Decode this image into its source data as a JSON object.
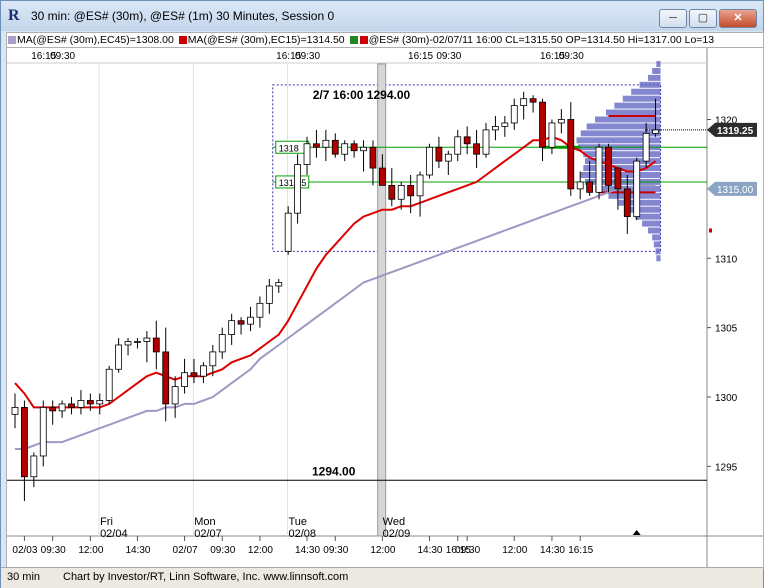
{
  "window": {
    "title": "30 min: @ES# (30m), @ES# (1m) 30 Minutes, Session 0",
    "minimize_label": "─",
    "maximize_label": "▢",
    "close_label": "✕"
  },
  "legend": [
    {
      "text": "MA(@ES# (30m),EC45)=1308.00",
      "color": "#a8a0cc"
    },
    {
      "text": "MA(@ES# (30m),EC15)=1314.50",
      "color": "#cc0000"
    },
    {
      "text": "@ES# (30m)-02/07/11 16:00 CL=1315.50 OP=1314.50 Hi=1317.00 Lo=13",
      "color": "#228822",
      "color2": "#cc0000"
    }
  ],
  "colors": {
    "ema15": "#dd0000",
    "ema45": "#9d98c4",
    "up_candle": "#ffffff",
    "down_candle": "#b00000",
    "profile_fill": "#5a5fc0",
    "range_box": "#3333aa",
    "hline": "#00a000",
    "last_price": "#2c2c2c",
    "price_tag_gray": "#8ca4c4"
  },
  "chart_data": {
    "type": "candlestick",
    "ylim": [
      1292,
      1324
    ],
    "y_ticks": [
      "1320",
      "1315",
      "1310",
      "1305",
      "1300",
      "1295"
    ],
    "top_time_labels": [
      {
        "text": "16:15",
        "bar": 3
      },
      {
        "text": "09:30",
        "bar": 5
      },
      {
        "text": "16:15",
        "bar": 29
      },
      {
        "text": "09:30",
        "bar": 31
      },
      {
        "text": "16:15",
        "bar": 43
      },
      {
        "text": "09:30",
        "bar": 46
      },
      {
        "text": "16:15",
        "bar": 57
      },
      {
        "text": "09:30",
        "bar": 59
      }
    ],
    "bottom_time_labels": [
      {
        "text": "02/03",
        "bar": 1
      },
      {
        "text": "09:30",
        "bar": 4
      },
      {
        "text": "12:00",
        "bar": 8
      },
      {
        "text": "14:30",
        "bar": 13
      },
      {
        "text": "02/07",
        "bar": 18
      },
      {
        "text": "09:30",
        "bar": 22
      },
      {
        "text": "12:00",
        "bar": 26
      },
      {
        "text": "14:30",
        "bar": 31
      },
      {
        "text": "09:30",
        "bar": 34
      },
      {
        "text": "12:00",
        "bar": 39
      },
      {
        "text": "14:30",
        "bar": 44
      },
      {
        "text": "16:15",
        "bar": 47
      },
      {
        "text": "09:30",
        "bar": 48
      },
      {
        "text": "12:00",
        "bar": 53
      },
      {
        "text": "14:30",
        "bar": 57
      },
      {
        "text": "16:15",
        "bar": 60
      }
    ],
    "day_labels": [
      {
        "day": "Fri",
        "date": "02/04",
        "bar": 9
      },
      {
        "day": "Mon",
        "date": "02/07",
        "bar": 19
      },
      {
        "day": "Tue",
        "date": "02/08",
        "bar": 29
      },
      {
        "day": "Wed",
        "date": "02/09",
        "bar": 39
      }
    ],
    "candles": [
      [
        1298.75,
        1300.25,
        1297.75,
        1299.25
      ],
      [
        1299.25,
        1299.75,
        1292.5,
        1294.25
      ],
      [
        1294.25,
        1296.0,
        1293.5,
        1295.75
      ],
      [
        1295.75,
        1299.75,
        1295.0,
        1299.25
      ],
      [
        1299.25,
        1299.75,
        1298.0,
        1299.0
      ],
      [
        1299.0,
        1299.75,
        1298.5,
        1299.5
      ],
      [
        1299.5,
        1300.0,
        1298.75,
        1299.25
      ],
      [
        1299.25,
        1300.5,
        1298.75,
        1299.75
      ],
      [
        1299.75,
        1300.25,
        1299.0,
        1299.5
      ],
      [
        1299.5,
        1300.25,
        1298.75,
        1299.75
      ],
      [
        1299.75,
        1302.25,
        1299.5,
        1302.0
      ],
      [
        1302.0,
        1304.25,
        1301.75,
        1303.75
      ],
      [
        1303.75,
        1304.25,
        1303.0,
        1304.0
      ],
      [
        1304.0,
        1304.25,
        1303.5,
        1304.0
      ],
      [
        1304.0,
        1304.75,
        1302.5,
        1304.25
      ],
      [
        1304.25,
        1305.5,
        1302.0,
        1303.25
      ],
      [
        1303.25,
        1305.0,
        1298.25,
        1299.5
      ],
      [
        1299.5,
        1301.5,
        1298.5,
        1300.75
      ],
      [
        1300.75,
        1302.75,
        1300.25,
        1301.75
      ],
      [
        1301.75,
        1302.75,
        1301.0,
        1301.5
      ],
      [
        1301.5,
        1302.5,
        1301.0,
        1302.25
      ],
      [
        1302.25,
        1303.75,
        1301.5,
        1303.25
      ],
      [
        1303.25,
        1305.0,
        1302.75,
        1304.5
      ],
      [
        1304.5,
        1306.0,
        1303.75,
        1305.5
      ],
      [
        1305.5,
        1305.75,
        1304.5,
        1305.25
      ],
      [
        1305.25,
        1306.5,
        1304.75,
        1305.75
      ],
      [
        1305.75,
        1307.25,
        1305.0,
        1306.75
      ],
      [
        1306.75,
        1308.5,
        1306.0,
        1308.0
      ],
      [
        1308.0,
        1308.5,
        1307.5,
        1308.25
      ],
      [
        1310.5,
        1313.75,
        1310.25,
        1313.25
      ],
      [
        1313.25,
        1317.5,
        1312.5,
        1316.75
      ],
      [
        1316.75,
        1318.75,
        1316.0,
        1318.25
      ],
      [
        1318.25,
        1319.25,
        1317.25,
        1318.0
      ],
      [
        1318.0,
        1319.25,
        1317.0,
        1318.5
      ],
      [
        1318.5,
        1319.0,
        1317.25,
        1317.5
      ],
      [
        1317.5,
        1318.5,
        1317.0,
        1318.25
      ],
      [
        1318.25,
        1318.5,
        1317.25,
        1317.75
      ],
      [
        1317.75,
        1318.5,
        1316.25,
        1318.0
      ],
      [
        1318.0,
        1318.5,
        1315.25,
        1316.5
      ],
      [
        1316.5,
        1317.5,
        1315.25,
        1315.25
      ],
      [
        1315.25,
        1316.5,
        1313.75,
        1314.25
      ],
      [
        1314.25,
        1315.5,
        1313.5,
        1315.25
      ],
      [
        1315.25,
        1316.0,
        1313.25,
        1314.5
      ],
      [
        1314.5,
        1316.25,
        1313.0,
        1316.0
      ],
      [
        1316.0,
        1318.25,
        1315.75,
        1318.0
      ],
      [
        1318.0,
        1318.75,
        1316.5,
        1317.0
      ],
      [
        1317.0,
        1317.75,
        1316.0,
        1317.5
      ],
      [
        1317.5,
        1319.25,
        1317.0,
        1318.75
      ],
      [
        1318.75,
        1319.5,
        1317.5,
        1318.25
      ],
      [
        1318.25,
        1319.25,
        1316.5,
        1317.5
      ],
      [
        1317.5,
        1319.75,
        1317.25,
        1319.25
      ],
      [
        1319.25,
        1320.25,
        1318.5,
        1319.5
      ],
      [
        1319.5,
        1320.25,
        1318.75,
        1319.75
      ],
      [
        1319.75,
        1321.5,
        1319.25,
        1321.0
      ],
      [
        1321.0,
        1322.0,
        1320.0,
        1321.5
      ],
      [
        1321.5,
        1321.75,
        1320.5,
        1321.25
      ],
      [
        1321.25,
        1321.5,
        1317.0,
        1318.0
      ],
      [
        1318.0,
        1320.0,
        1317.5,
        1319.75
      ],
      [
        1319.75,
        1320.75,
        1319.0,
        1320.0
      ],
      [
        1320.0,
        1321.25,
        1314.5,
        1315.0
      ],
      [
        1315.0,
        1316.25,
        1314.25,
        1315.5
      ],
      [
        1315.5,
        1317.0,
        1314.5,
        1314.75
      ],
      [
        1314.75,
        1318.25,
        1314.25,
        1318.0
      ],
      [
        1318.0,
        1318.25,
        1314.75,
        1315.25
      ],
      [
        1316.5,
        1316.5,
        1313.5,
        1315.0
      ],
      [
        1315.0,
        1316.0,
        1311.75,
        1313.0
      ],
      [
        1313.0,
        1317.25,
        1312.75,
        1317.0
      ],
      [
        1317.0,
        1319.75,
        1316.5,
        1319.0
      ],
      [
        1319.0,
        1321.5,
        1318.75,
        1319.25
      ]
    ],
    "ema15_values": [
      1301.0,
      1300.25,
      1299.25,
      1299.25,
      1299.25,
      1299.25,
      1299.25,
      1299.25,
      1299.25,
      1299.25,
      1299.5,
      1300.0,
      1300.5,
      1301.0,
      1301.5,
      1301.75,
      1301.5,
      1301.25,
      1301.5,
      1301.5,
      1301.5,
      1301.75,
      1302.0,
      1302.5,
      1302.75,
      1303.0,
      1303.5,
      1304.0,
      1304.5,
      1305.5,
      1306.75,
      1308.0,
      1309.25,
      1310.25,
      1311.0,
      1311.75,
      1312.5,
      1313.0,
      1313.25,
      1313.5,
      1313.5,
      1313.75,
      1313.75,
      1314.0,
      1314.25,
      1314.5,
      1314.75,
      1315.0,
      1315.25,
      1315.5,
      1316.0,
      1316.5,
      1317.0,
      1317.5,
      1318.0,
      1318.5,
      1318.5,
      1318.75,
      1318.5,
      1318.0,
      1317.75,
      1317.25,
      1317.0,
      1316.75,
      1316.5,
      1316.25,
      1316.25,
      1316.5,
      1317.0
    ],
    "ema45_values": [
      1296.25,
      1296.25,
      1296.5,
      1296.75,
      1296.75,
      1296.75,
      1297.0,
      1297.25,
      1297.5,
      1297.75,
      1298.0,
      1298.25,
      1298.5,
      1298.75,
      1299.0,
      1299.0,
      1299.25,
      1299.25,
      1299.5,
      1299.5,
      1299.75,
      1300.0,
      1300.5,
      1301.0,
      1301.5,
      1302.0,
      1302.75,
      1303.25,
      1303.75,
      1304.25,
      1304.75,
      1305.25,
      1305.75,
      1306.25,
      1306.75,
      1307.25,
      1307.75,
      1308.25,
      1308.5,
      1308.75,
      1309.0,
      1309.25,
      1309.5,
      1309.75,
      1310.0,
      1310.25,
      1310.5,
      1310.75,
      1311.0,
      1311.25,
      1311.5,
      1311.75,
      1312.0,
      1312.25,
      1312.5,
      1312.75,
      1313.0,
      1313.25,
      1313.5,
      1313.75,
      1314.0,
      1314.25,
      1314.5,
      1314.75,
      1315.0,
      1315.0,
      1315.25,
      1315.25,
      1315.25
    ],
    "volume_profile": [
      {
        "price": 1324.0,
        "width": 0.05
      },
      {
        "price": 1323.5,
        "width": 0.1
      },
      {
        "price": 1323.0,
        "width": 0.15
      },
      {
        "price": 1322.5,
        "width": 0.25
      },
      {
        "price": 1322.0,
        "width": 0.35
      },
      {
        "price": 1321.5,
        "width": 0.45
      },
      {
        "price": 1321.0,
        "width": 0.55
      },
      {
        "price": 1320.5,
        "width": 0.65
      },
      {
        "price": 1320.0,
        "width": 0.78
      },
      {
        "price": 1319.5,
        "width": 0.88
      },
      {
        "price": 1319.0,
        "width": 0.95
      },
      {
        "price": 1318.5,
        "width": 1.0
      },
      {
        "price": 1318.0,
        "width": 0.98
      },
      {
        "price": 1317.5,
        "width": 0.92
      },
      {
        "price": 1317.0,
        "width": 0.9
      },
      {
        "price": 1316.5,
        "width": 0.92
      },
      {
        "price": 1316.0,
        "width": 0.95
      },
      {
        "price": 1315.5,
        "width": 0.9
      },
      {
        "price": 1315.0,
        "width": 0.78
      },
      {
        "price": 1314.5,
        "width": 0.62
      },
      {
        "price": 1314.0,
        "width": 0.5
      },
      {
        "price": 1313.5,
        "width": 0.4
      },
      {
        "price": 1313.0,
        "width": 0.3
      },
      {
        "price": 1312.5,
        "width": 0.22
      },
      {
        "price": 1312.0,
        "width": 0.15
      },
      {
        "price": 1311.5,
        "width": 0.1
      },
      {
        "price": 1311.0,
        "width": 0.08
      },
      {
        "price": 1310.5,
        "width": 0.06
      },
      {
        "price": 1310.0,
        "width": 0.05
      }
    ],
    "annotations": {
      "range_box_label": "2/7 16:00  1294.00",
      "level_label": "1294.00",
      "level_price": 1294.0,
      "hline1_label": "1318",
      "hline1_price": 1318.0,
      "hline2_label": "1315.5",
      "hline2_price": 1315.5,
      "last_price_label": "1319.25",
      "last_price": 1319.25,
      "gray_tag_label": "1315.00",
      "gray_tag_price": 1315.0
    }
  },
  "statusbar": {
    "interval": "30 min",
    "credit": "Chart by Investor/RT, Linn Software, Inc. www.linnsoft.com"
  }
}
